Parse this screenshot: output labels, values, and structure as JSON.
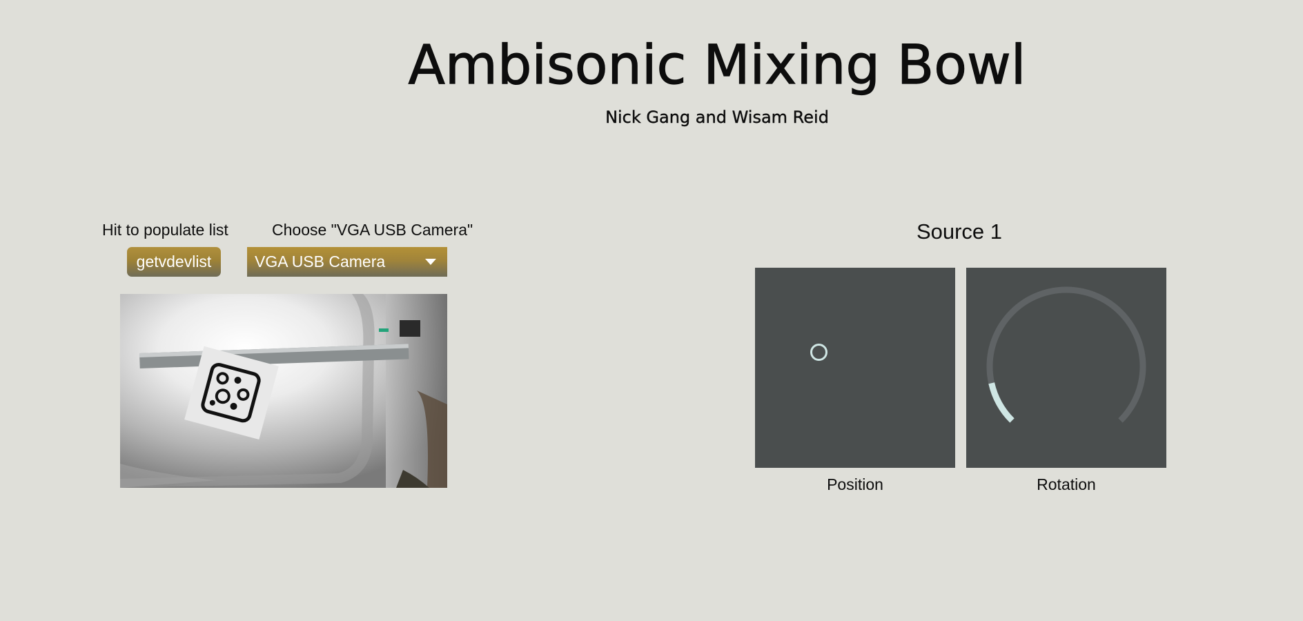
{
  "header": {
    "title": "Ambisonic Mixing Bowl",
    "subtitle": "Nick Gang and Wisam Reid"
  },
  "video_device": {
    "populate_hint": "Hit to populate list",
    "choose_hint": "Choose \"VGA USB Camera\"",
    "refresh_button_label": "getvdevlist",
    "selected_device": "VGA USB Camera",
    "button_color": "#a38638",
    "menu_color": "#a38638"
  },
  "camera_preview": {
    "subject": "fiducial marker on bowl"
  },
  "source": {
    "title": "Source 1",
    "position_label": "Position",
    "rotation_label": "Rotation",
    "panel_color": "#4a4e4e",
    "accent_color": "#cfe6e4",
    "rotation_value_fraction": 0.12
  }
}
